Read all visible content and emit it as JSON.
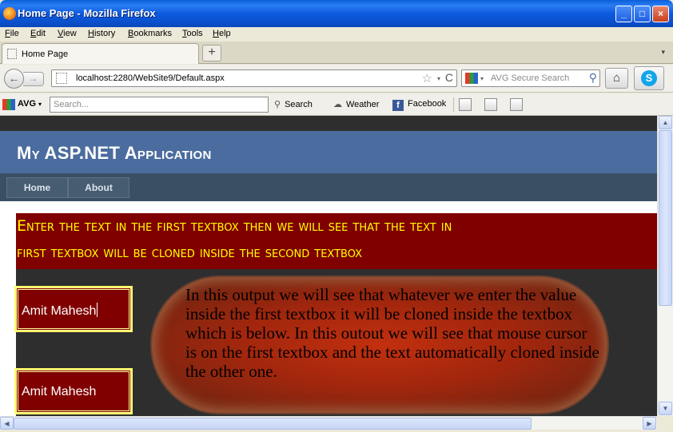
{
  "window": {
    "title": "Home Page - Mozilla Firefox",
    "minimize": "_",
    "maximize": "□",
    "close": "×"
  },
  "menubar": [
    "File",
    "Edit",
    "View",
    "History",
    "Bookmarks",
    "Tools",
    "Help"
  ],
  "tabs": {
    "active_label": "Home Page",
    "new_tab": "+",
    "list_arrow": "▾"
  },
  "nav": {
    "back": "←",
    "forward": "→",
    "url": "localhost:2280/WebSite9/Default.aspx",
    "bookmark_star": "☆",
    "dropdown": "▾",
    "reload": "C",
    "search_placeholder": "AVG Secure Search",
    "search_go": "⚲",
    "home": "⌂",
    "skype": "S"
  },
  "avg_toolbar": {
    "logo_label": "AVG",
    "logo_dropdown": "▾",
    "search_placeholder": "Search...",
    "search_label": "Search",
    "weather_label": "Weather",
    "facebook_label": "Facebook",
    "facebook_glyph": "f"
  },
  "page": {
    "app_title": "My ASP.NET Application",
    "menu_items": [
      "Home",
      "About"
    ],
    "banner_lines": [
      "Enter the text in the first textbox then we will see that the text in",
      "first textbox will be cloned inside the second textbox"
    ],
    "textbox1_value": "Amit Mahesh",
    "textbox2_value": "Amit Mahesh",
    "bubble_text": "In this output we will see that whatever we enter the value inside the first textbox it will be cloned inside the textbox which is below. In this outout we will see that mouse cursor is on the first textbox and the text automatically cloned inside the other one."
  },
  "scroll": {
    "up": "▲",
    "down": "▼",
    "left": "◀",
    "right": "▶"
  },
  "colors": {
    "header_blue": "#4b6c9e",
    "menu_dark": "#3a4f63",
    "banner_red": "#800000",
    "banner_text": "#ffff00"
  }
}
